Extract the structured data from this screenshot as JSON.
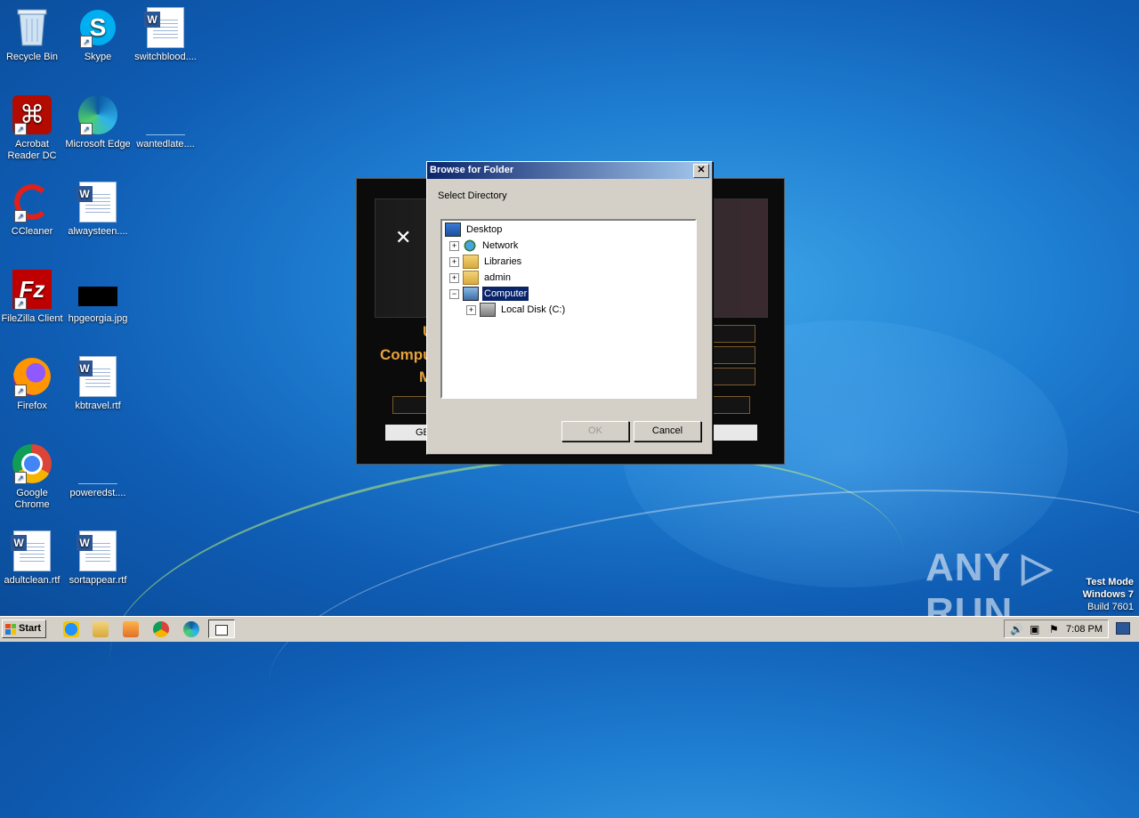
{
  "desktop": {
    "icons": [
      {
        "label": "Recycle Bin"
      },
      {
        "label": "Skype"
      },
      {
        "label": "switchblood...."
      },
      {
        "label": "Acrobat Reader DC"
      },
      {
        "label": "Microsoft Edge"
      },
      {
        "label": "wantedlate...."
      },
      {
        "label": "CCleaner"
      },
      {
        "label": "alwaysteen...."
      },
      {
        "label": "FileZilla Client"
      },
      {
        "label": "hpgeorgia.jpg"
      },
      {
        "label": "Firefox"
      },
      {
        "label": "kbtravel.rtf"
      },
      {
        "label": "Google Chrome"
      },
      {
        "label": "poweredst...."
      },
      {
        "label": "adultclean.rtf"
      },
      {
        "label": "sortappear.rtf"
      }
    ]
  },
  "background_app": {
    "text1": "U",
    "text2": "Compu",
    "text3": "M",
    "button": "GE"
  },
  "dialog": {
    "title": "Browse for Folder",
    "close": "✕",
    "prompt": "Select Directory",
    "tree": [
      {
        "label": "Desktop",
        "expander": ""
      },
      {
        "label": "Network",
        "expander": "+"
      },
      {
        "label": "Libraries",
        "expander": "+"
      },
      {
        "label": "admin",
        "expander": "+"
      },
      {
        "label": "Computer",
        "expander": "−"
      },
      {
        "label": "Local Disk (C:)",
        "expander": "+"
      }
    ],
    "ok": "OK",
    "cancel": "Cancel"
  },
  "taskbar": {
    "start": "Start",
    "clock": "7:08 PM"
  },
  "watermark": {
    "line1": "Test Mode",
    "line2": "Windows 7",
    "line3": "Build 7601",
    "brand": "ANY ▷ RUN"
  }
}
